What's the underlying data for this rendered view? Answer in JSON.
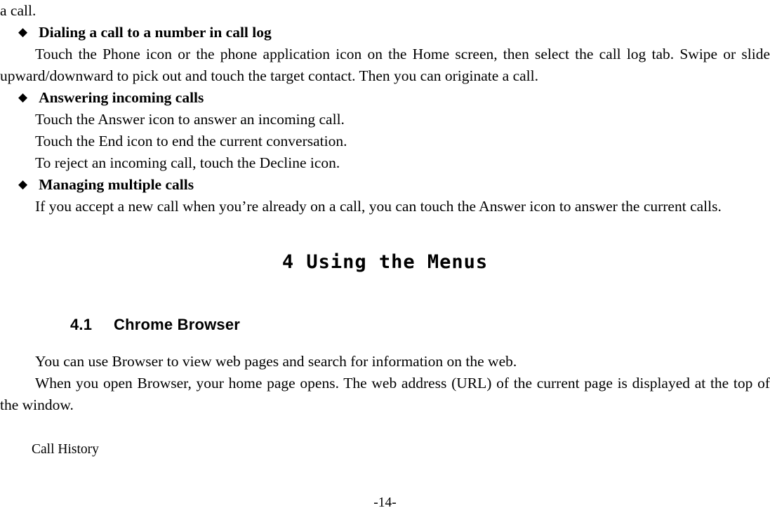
{
  "document": {
    "top_fragment": "a call.",
    "blocks": [
      {
        "type": "bullet",
        "glyph": "◆",
        "heading": "Dialing a call to a number in call log",
        "paragraph": "Touch the Phone icon or the phone application icon on the Home screen, then select the call log tab. Swipe or slide upward/downward to pick out and touch the target contact. Then you can originate a call."
      },
      {
        "type": "bullet",
        "glyph": "◆",
        "heading": "Answering incoming calls",
        "lines": [
          "Touch the Answer icon to answer an incoming call.",
          "Touch the End icon to end the current conversation.",
          "To reject an incoming call, touch the Decline icon."
        ]
      },
      {
        "type": "bullet",
        "glyph": "◆",
        "heading": "Managing multiple calls",
        "paragraph": "If you accept a new call when you’re already on a call, you can touch the Answer icon to answer the current calls."
      }
    ],
    "chapter_title": "4 Using the Menus",
    "section": {
      "number": "4.1",
      "title": "Chrome Browser"
    },
    "section_paragraphs": [
      "You can use Browser to view web pages and search for information on the web.",
      "When you open Browser, your home page opens. The web address (URL) of the current page is displayed at the top of the window."
    ],
    "call_history_label": "Call History",
    "page_number": "-14-"
  }
}
